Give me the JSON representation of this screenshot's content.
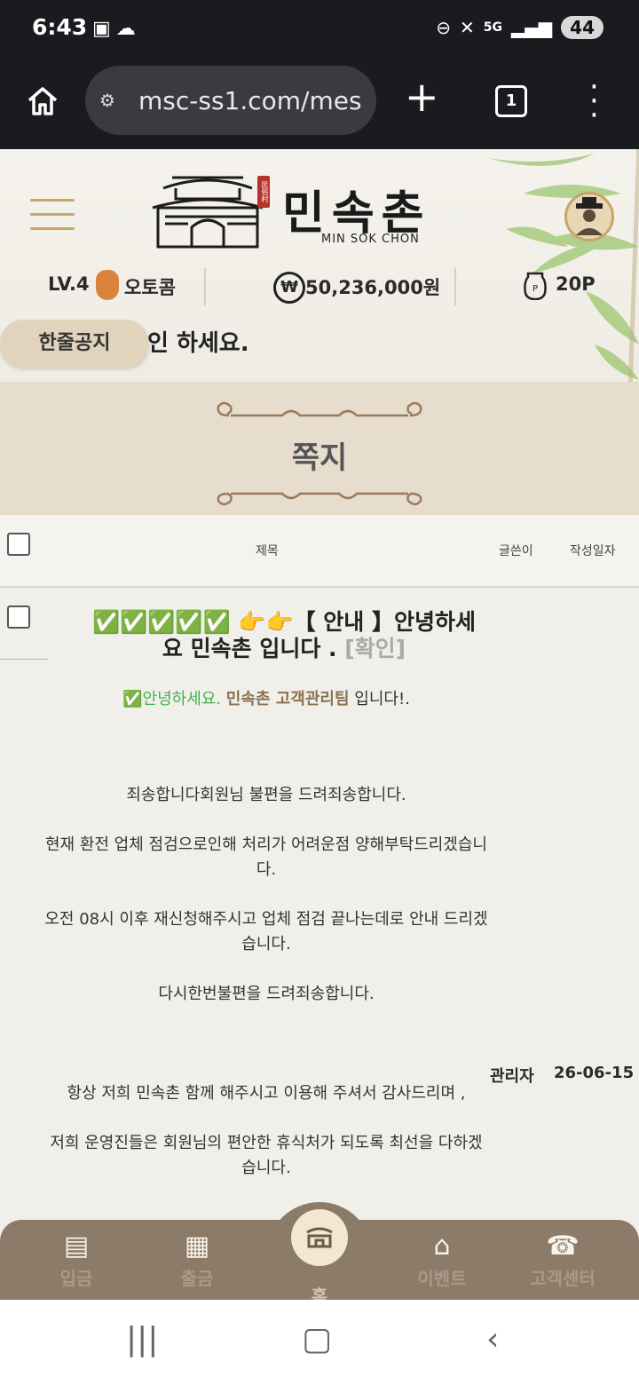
{
  "status": {
    "time": "6:43",
    "battery": "44",
    "network": "5G"
  },
  "browser": {
    "url": "msc-ss1.com/mes",
    "tab_count": "1"
  },
  "header": {
    "logo_text": "민속촌",
    "logo_sub": "MIN SOK CHON",
    "logo_seal": "民俗村",
    "level": "LV.4",
    "level_name": "오토콤",
    "money": "50,236,000원",
    "points": "20P",
    "notice_label": "한줄공지",
    "notice_text": "인 하세요."
  },
  "page": {
    "title": "쪽지"
  },
  "table": {
    "columns": {
      "subject": "제목",
      "author": "글쓴이",
      "date": "작성일자"
    }
  },
  "message": {
    "title_checks": "✅✅✅✅✅",
    "title_point": "👉👉",
    "title_text": "【 안내 】안녕하세요 민속촌 입니다 .",
    "title_status": "[확인]",
    "author": "관리자",
    "date": "26-06-15",
    "greeting_prefix": "✅안녕하세요.",
    "greeting_team": "민속촌 고객관리팀",
    "greeting_suffix": "입니다!.",
    "lines": [
      "죄송합니다회원님 불편을 드려죄송합니다.",
      "현재 환전 업체 점검으로인해 처리가 어려운점 양해부탁드리겠습니다.",
      "오전 08시 이후 재신청해주시고 업체 점검 끝나는데로 안내 드리겠습니다.",
      "다시한번불편을 드려죄송합니다.",
      "항상 저희 민속촌 함께 해주시고 이용해 주셔서 감사드리며 ,",
      "저희 운영진들은 회원님의 편안한 휴식처가 되도록 최선을 다하겠습니다."
    ]
  },
  "nav": {
    "deposit": "입금",
    "withdraw": "출금",
    "home": "홈",
    "event": "이벤트",
    "support": "고객센터"
  }
}
